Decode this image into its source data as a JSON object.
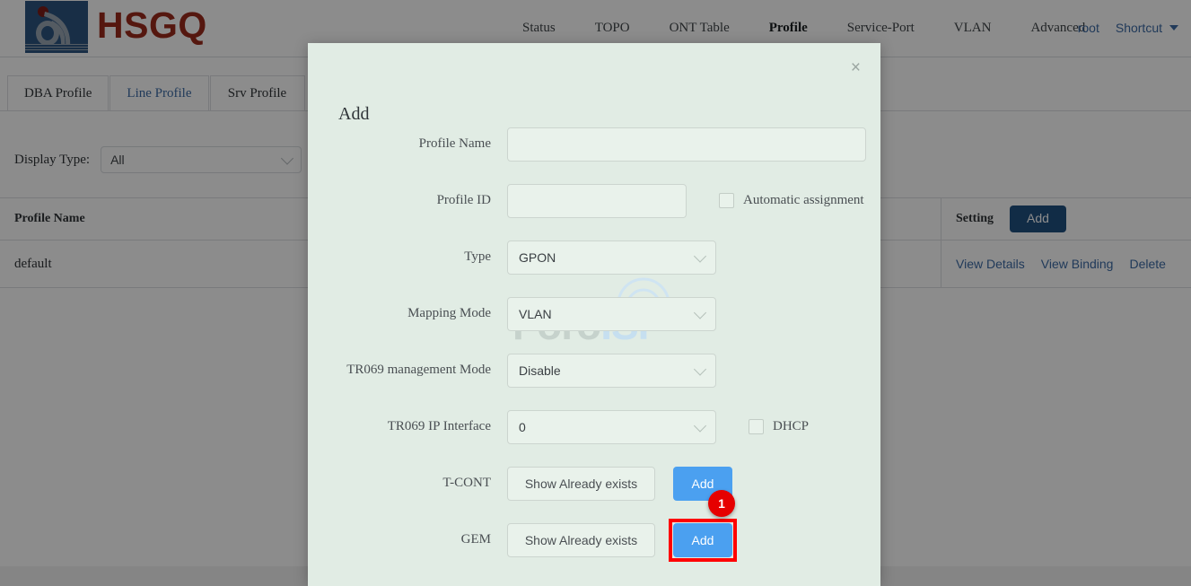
{
  "header": {
    "logo_text": "HSGQ",
    "nav_items": [
      {
        "label": "Status",
        "active": false
      },
      {
        "label": "TOPO",
        "active": false
      },
      {
        "label": "ONT Table",
        "active": false
      },
      {
        "label": "Profile",
        "active": true
      },
      {
        "label": "Service-Port",
        "active": false
      },
      {
        "label": "VLAN",
        "active": false
      },
      {
        "label": "Advanced",
        "active": false
      }
    ],
    "user_label": "root",
    "shortcut_label": "Shortcut"
  },
  "tabs": [
    {
      "label": "DBA Profile",
      "active": false
    },
    {
      "label": "Line Profile",
      "active": true
    },
    {
      "label": "Srv Profile",
      "active": false
    }
  ],
  "filter": {
    "label": "Display Type:",
    "value": "All"
  },
  "table": {
    "headers": [
      "Profile Name",
      "",
      "",
      "Setting"
    ],
    "header_action": "Add",
    "rows": [
      {
        "profile_name": "default",
        "actions": [
          "View Details",
          "View Binding",
          "Delete"
        ]
      }
    ]
  },
  "modal": {
    "title": "Add",
    "close_icon": "×",
    "watermark_part1": "Foro",
    "watermark_part2": "ISP",
    "fields": {
      "profile_name": {
        "label": "Profile Name",
        "value": "",
        "placeholder": ""
      },
      "profile_id": {
        "label": "Profile ID",
        "value": "",
        "placeholder": ""
      },
      "automatic_assignment": {
        "label": "Automatic assignment",
        "checked": false
      },
      "type": {
        "label": "Type",
        "value": "GPON"
      },
      "mapping_mode": {
        "label": "Mapping Mode",
        "value": "VLAN"
      },
      "tr069_management_mode": {
        "label": "TR069 management Mode",
        "value": "Disable"
      },
      "tr069_ip_interface": {
        "label": "TR069 IP Interface",
        "value": "0"
      },
      "dhcp": {
        "label": "DHCP",
        "checked": false
      },
      "tcont": {
        "label": "T-CONT",
        "show_label": "Show Already exists",
        "add_label": "Add"
      },
      "gem": {
        "label": "GEM",
        "show_label": "Show Already exists",
        "add_label": "Add"
      }
    },
    "highlight_badge": "1"
  },
  "colors": {
    "brand_red": "#9c2a1c",
    "logo_blue": "#2c5580",
    "link_blue": "#3c6ba5",
    "primary_blue": "#4ba0f0",
    "dark_blue_btn": "#205080",
    "modal_bg": "#e1ece4",
    "highlight_red": "#ff0000",
    "badge_red": "#e60000"
  }
}
